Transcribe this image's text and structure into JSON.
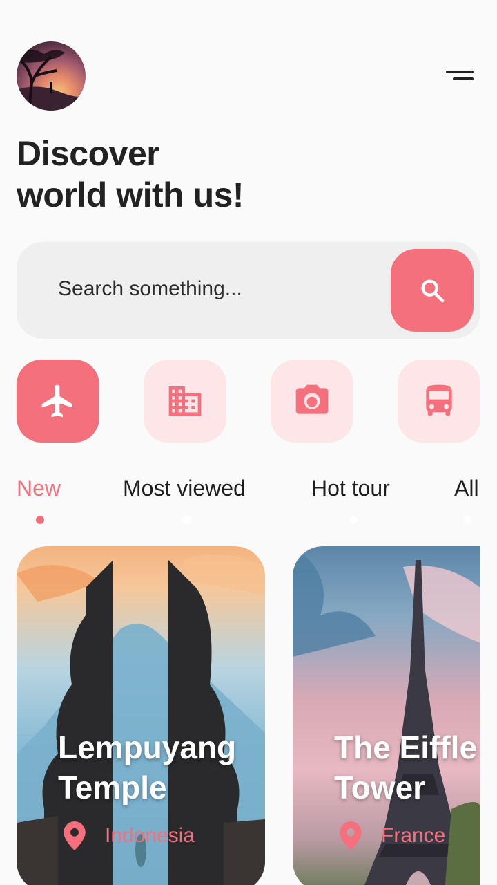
{
  "header": {
    "avatar_alt": "profile photo",
    "menu_icon": "menu-icon"
  },
  "headline": {
    "line1": "Discover",
    "line2": "world with us!"
  },
  "search": {
    "placeholder": "Search something...",
    "button_icon": "search-icon"
  },
  "categories": [
    {
      "icon": "airplane-icon",
      "active": true
    },
    {
      "icon": "building-icon",
      "active": false
    },
    {
      "icon": "camera-icon",
      "active": false
    },
    {
      "icon": "bus-icon",
      "active": false
    }
  ],
  "tabs": [
    {
      "label": "New",
      "active": true
    },
    {
      "label": "Most viewed",
      "active": false
    },
    {
      "label": "Hot tour",
      "active": false
    },
    {
      "label": "All",
      "active": false
    }
  ],
  "cards": [
    {
      "title": "Lempuyang\nTemple",
      "location": "Indonesia",
      "icon": "location-pin-icon"
    },
    {
      "title": "The Eiffle\nTower",
      "location": "France",
      "icon": "location-pin-icon"
    }
  ],
  "colors": {
    "accent": "#f3707c",
    "accent_light": "#fde5e8",
    "background": "#fafafa",
    "search_bg": "#efefef"
  }
}
